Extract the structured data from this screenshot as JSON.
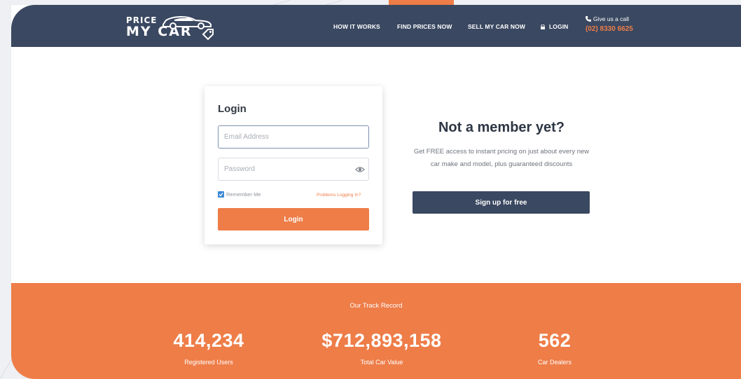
{
  "header": {
    "logo_line1": "PRICE",
    "logo_line2": "MY CAR",
    "nav": [
      {
        "label": "HOW IT WORKS"
      },
      {
        "label": "FIND PRICES NOW"
      },
      {
        "label": "SELL MY CAR NOW"
      },
      {
        "label": "LOGIN",
        "icon": "lock-icon"
      }
    ],
    "call_label": "Give us a call",
    "call_number": "(02) 8330 6625"
  },
  "login": {
    "title": "Login",
    "email_placeholder": "Email Address",
    "email_value": "",
    "password_placeholder": "Password",
    "password_value": "",
    "remember_label": "Remember Me",
    "remember_checked": true,
    "problems_link": "Problems Logging In?",
    "submit_label": "Login"
  },
  "promo": {
    "title": "Not a member yet?",
    "text": "Get FREE access to instant pricing on just about every new car make and model, plus guaranteed discounts",
    "button_label": "Sign up for free"
  },
  "track_record": {
    "heading": "Our Track Record",
    "stats": [
      {
        "value": "414,234",
        "label": "Registered Users"
      },
      {
        "value": "$712,893,158",
        "label": "Total Car Value"
      },
      {
        "value": "562",
        "label": "Car Dealers"
      }
    ]
  },
  "colors": {
    "navy": "#3a4861",
    "orange": "#ee7d48",
    "checkbox_blue": "#3c88d6"
  }
}
